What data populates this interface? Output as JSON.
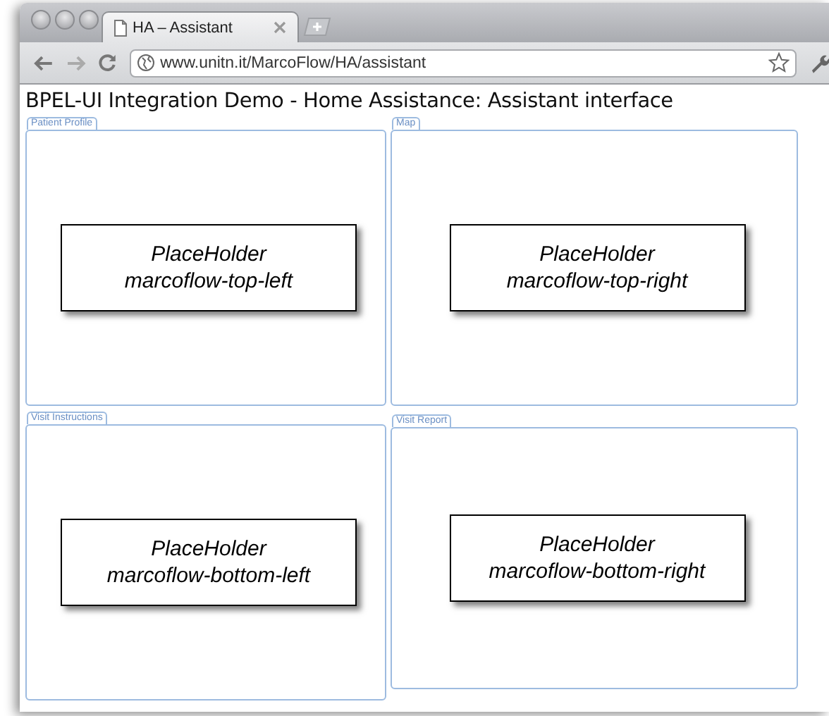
{
  "browser": {
    "tab": {
      "title": "HA – Assistant",
      "selected": true
    },
    "url": "www.unitn.it/MarcoFlow/HA/assistant"
  },
  "page": {
    "heading": "BPEL-UI Integration Demo - Home Assistance: Assistant interface",
    "panels": [
      {
        "legend": "Patient Profile",
        "placeholder": [
          "PlaceHolder",
          "marcoflow-top-left"
        ]
      },
      {
        "legend": "Map",
        "placeholder": [
          "PlaceHolder",
          "marcoflow-top-right"
        ]
      },
      {
        "legend": "Visit Instructions",
        "placeholder": [
          "PlaceHolder",
          "marcoflow-bottom-left"
        ]
      },
      {
        "legend": "Visit Report",
        "placeholder": [
          "PlaceHolder",
          "marcoflow-bottom-right"
        ]
      }
    ]
  }
}
